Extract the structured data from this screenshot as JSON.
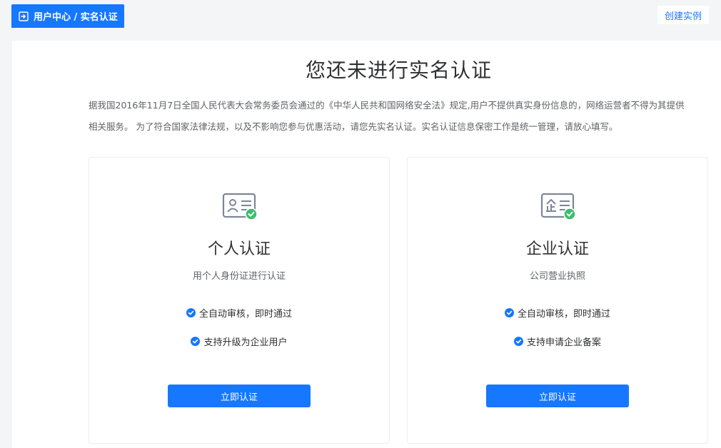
{
  "header": {
    "breadcrumb": "用户中心 / 实名认证",
    "create_instance": "创建实例"
  },
  "main": {
    "title": "您还未进行实名认证",
    "notice_line1": "据我国2016年11月7日全国人民代表大会常务委员会通过的《中华人民共和国网络安全法》规定,用户不提供真实身份信息的，网络运营者不得为其提供",
    "notice_line2": "相关服务。 为了符合国家法律法规，以及不影响您参与优惠活动，请您先实名认证。实名认证信息保密工作是统一管理，请放心填写。"
  },
  "cards": [
    {
      "title": "个人认证",
      "subtitle": "用个人身份证进行认证",
      "features": [
        "全自动审核，即时通过",
        "支持升级为企业用户"
      ],
      "button": "立即认证",
      "icon": "id-card-icon"
    },
    {
      "title": "企业认证",
      "subtitle": "公司营业执照",
      "features": [
        "全自动审核，即时通过",
        "支持申请企业备案"
      ],
      "button": "立即认证",
      "icon": "business-license-icon"
    }
  ],
  "colors": {
    "primary": "#1677ff",
    "success": "#3dbd6e",
    "icon_gray": "#7d8699"
  }
}
